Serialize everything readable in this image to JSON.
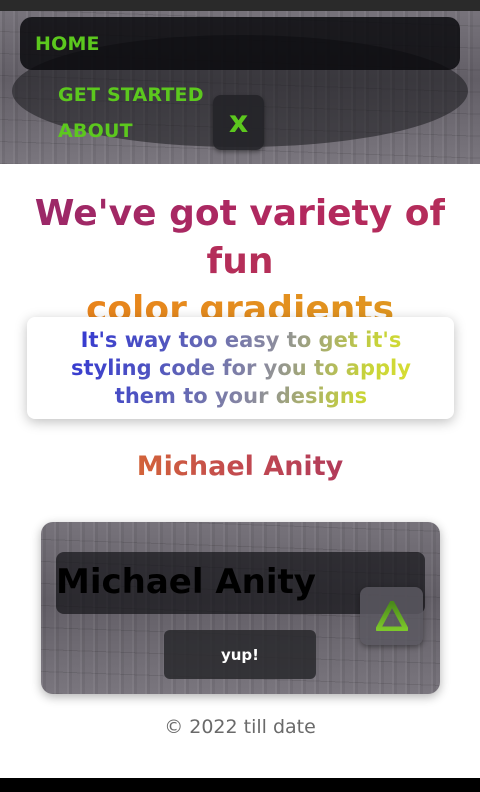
{
  "nav": {
    "home_label": "HOME",
    "get_started_label": "GET STARTED",
    "about_label": "ABOUT",
    "close_label": "x"
  },
  "hero": {
    "headline_line1": "We've got variety of fun",
    "headline_line2": "color gradients"
  },
  "tagline": {
    "text": "It's way too easy to get it's styling code for you to apply them to your designs"
  },
  "author": {
    "name": "Michael Anity"
  },
  "card": {
    "name": "Michael Anity",
    "button_label": "yup!",
    "triangle_icon": "triangle-icon"
  },
  "footer": {
    "copyright": "© 2022 till date"
  },
  "colors": {
    "nav_link": "#5cc81e",
    "headline_start": "#9b2868",
    "headline_end": "#e8841c",
    "tagline_start": "#2a2ed8",
    "tagline_end": "#e6e62c"
  }
}
